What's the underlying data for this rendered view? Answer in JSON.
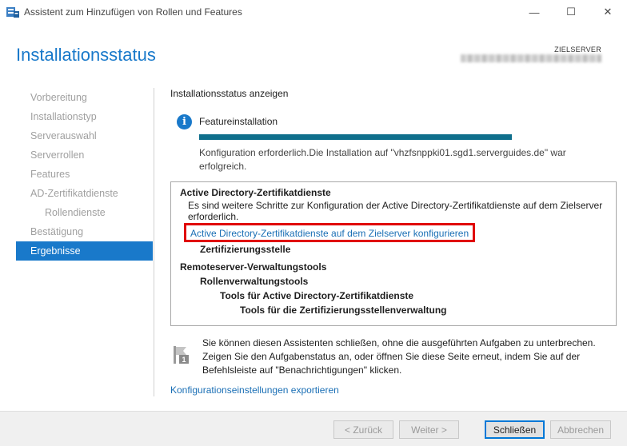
{
  "window": {
    "title": "Assistent zum Hinzufügen von Rollen und Features",
    "minimize_glyph": "—",
    "maximize_glyph": "☐",
    "close_glyph": "✕"
  },
  "header": {
    "page_title": "Installationsstatus",
    "server_label": "ZIELSERVER"
  },
  "nav": {
    "items": [
      {
        "label": "Vorbereitung"
      },
      {
        "label": "Installationstyp"
      },
      {
        "label": "Serverauswahl"
      },
      {
        "label": "Serverrollen"
      },
      {
        "label": "Features"
      },
      {
        "label": "AD-Zertifikatdienste"
      },
      {
        "label": "Rollendienste"
      },
      {
        "label": "Bestätigung"
      },
      {
        "label": "Ergebnisse"
      }
    ],
    "active_index": 8
  },
  "content": {
    "section_title": "Installationsstatus anzeigen",
    "info_glyph": "i",
    "feature_label": "Featureinstallation",
    "progress_fraction": 1.0,
    "status_text": "Konfiguration erforderlich.Die Installation auf \"vhzfsnppki01.sgd1.serverguides.de\" war erfolgreich."
  },
  "results": {
    "ad_title": "Active Directory-Zertifikatdienste",
    "ad_desc": "Es sind weitere Schritte zur Konfiguration der Active Directory-Zertifikatdienste auf dem Zielserver erforderlich.",
    "config_link": "Active Directory-Zertifikatdienste auf dem Zielserver konfigurieren",
    "ca": "Zertifizierungsstelle",
    "rsat": "Remoteserver-Verwaltungstools",
    "role_tools": "Rollenverwaltungstools",
    "ad_tools": "Tools für Active Directory-Zertifikatdienste",
    "ca_tools": "Tools für die Zertifizierungsstellenverwaltung"
  },
  "notification": {
    "text": "Sie können diesen Assistenten schließen, ohne die ausgeführten Aufgaben zu unterbrechen. Zeigen Sie den Aufgabenstatus an, oder öffnen Sie diese Seite erneut, indem Sie auf der Befehlsleiste auf \"Benachrichtigungen\" klicken.",
    "badge": "1"
  },
  "export_link": "Konfigurationseinstellungen exportieren",
  "buttons": {
    "back": "< Zurück",
    "next": "Weiter >",
    "close": "Schließen",
    "cancel": "Abbrechen"
  },
  "colors": {
    "accent": "#1979ca",
    "progress": "#0f6f8c",
    "highlight": "#e00000",
    "link": "#1a6fb5"
  }
}
